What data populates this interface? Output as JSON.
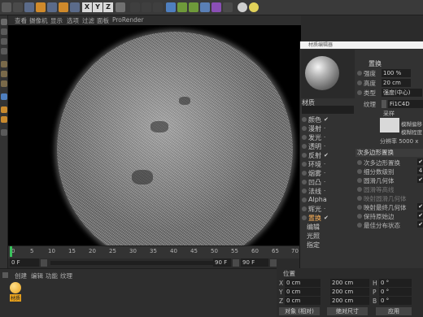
{
  "toolbar": {
    "axis_x": "X",
    "axis_y": "Y",
    "axis_z": "Z"
  },
  "viewport_menu": {
    "items": [
      "查看",
      "摄像机",
      "显示",
      "选项",
      "过滤",
      "面板",
      "ProRender"
    ]
  },
  "timeline": {
    "ticks": [
      "0",
      "5",
      "10",
      "15",
      "20",
      "25",
      "30",
      "35",
      "40",
      "45",
      "50",
      "55",
      "60",
      "65",
      "70"
    ],
    "current_frame": "0 F",
    "end_frame": "90 F",
    "preview_end": "90 F"
  },
  "material_manager": {
    "menu": [
      "创建",
      "编辑",
      "功能",
      "纹理"
    ],
    "material_name": "材质"
  },
  "coordinates": {
    "title": "位置",
    "rows": [
      {
        "axis": "X",
        "pos": "0 cm",
        "size": "200 cm",
        "rot_label": "H",
        "rot": "0 °"
      },
      {
        "axis": "Y",
        "pos": "0 cm",
        "size": "200 cm",
        "rot_label": "P",
        "rot": "0 °"
      },
      {
        "axis": "Z",
        "pos": "0 cm",
        "size": "200 cm",
        "rot_label": "B",
        "rot": "0 °"
      }
    ],
    "mode_object": "对象 (相对)",
    "mode_size": "绝对尺寸",
    "apply_button": "应用"
  },
  "material_editor": {
    "window_title": "材质编辑器",
    "material_name": "材质",
    "channels": [
      {
        "label": "颜色",
        "checked": true,
        "active": false
      },
      {
        "label": "漫射",
        "checked": false,
        "active": false
      },
      {
        "label": "发光",
        "checked": false,
        "active": false
      },
      {
        "label": "透明",
        "checked": false,
        "active": false
      },
      {
        "label": "反射",
        "checked": true,
        "active": false
      },
      {
        "label": "环境",
        "checked": false,
        "active": false
      },
      {
        "label": "烟雾",
        "checked": false,
        "active": false
      },
      {
        "label": "凹凸",
        "checked": false,
        "active": false
      },
      {
        "label": "法线",
        "checked": false,
        "active": false
      },
      {
        "label": "Alpha",
        "checked": false,
        "active": false
      },
      {
        "label": "辉光",
        "checked": false,
        "active": false
      },
      {
        "label": "置换",
        "checked": true,
        "active": true
      }
    ],
    "sub_items": [
      "编辑",
      "光照",
      "指定"
    ],
    "section_title": "置换",
    "strength_label": "强度",
    "strength_value": "100 %",
    "height_label": "高度",
    "height_value": "20 cm",
    "type_label": "类型",
    "type_value": "强度(中心)",
    "texture_label": "纹理",
    "texture_value": "Fi1C4D",
    "sampling_label": "采样",
    "blur_offset_label": "模糊偏移",
    "blur_scale_label": "模糊程度",
    "resolution_label": "分辨率 5000 x",
    "subpoly_section": "次多边形置换",
    "props": [
      {
        "label": "次多边形置换",
        "dim": false
      },
      {
        "label": "细分数级别",
        "dim": false,
        "value": "4"
      },
      {
        "label": "圆滑几何体",
        "dim": false
      },
      {
        "label": "圆滑等高线",
        "dim": true
      },
      {
        "label": "映射圆滑几何体",
        "dim": true
      },
      {
        "label": "映射最终几何体",
        "dim": false
      },
      {
        "label": "保持原始边",
        "dim": false
      },
      {
        "label": "最佳分布状态",
        "dim": false
      }
    ]
  }
}
